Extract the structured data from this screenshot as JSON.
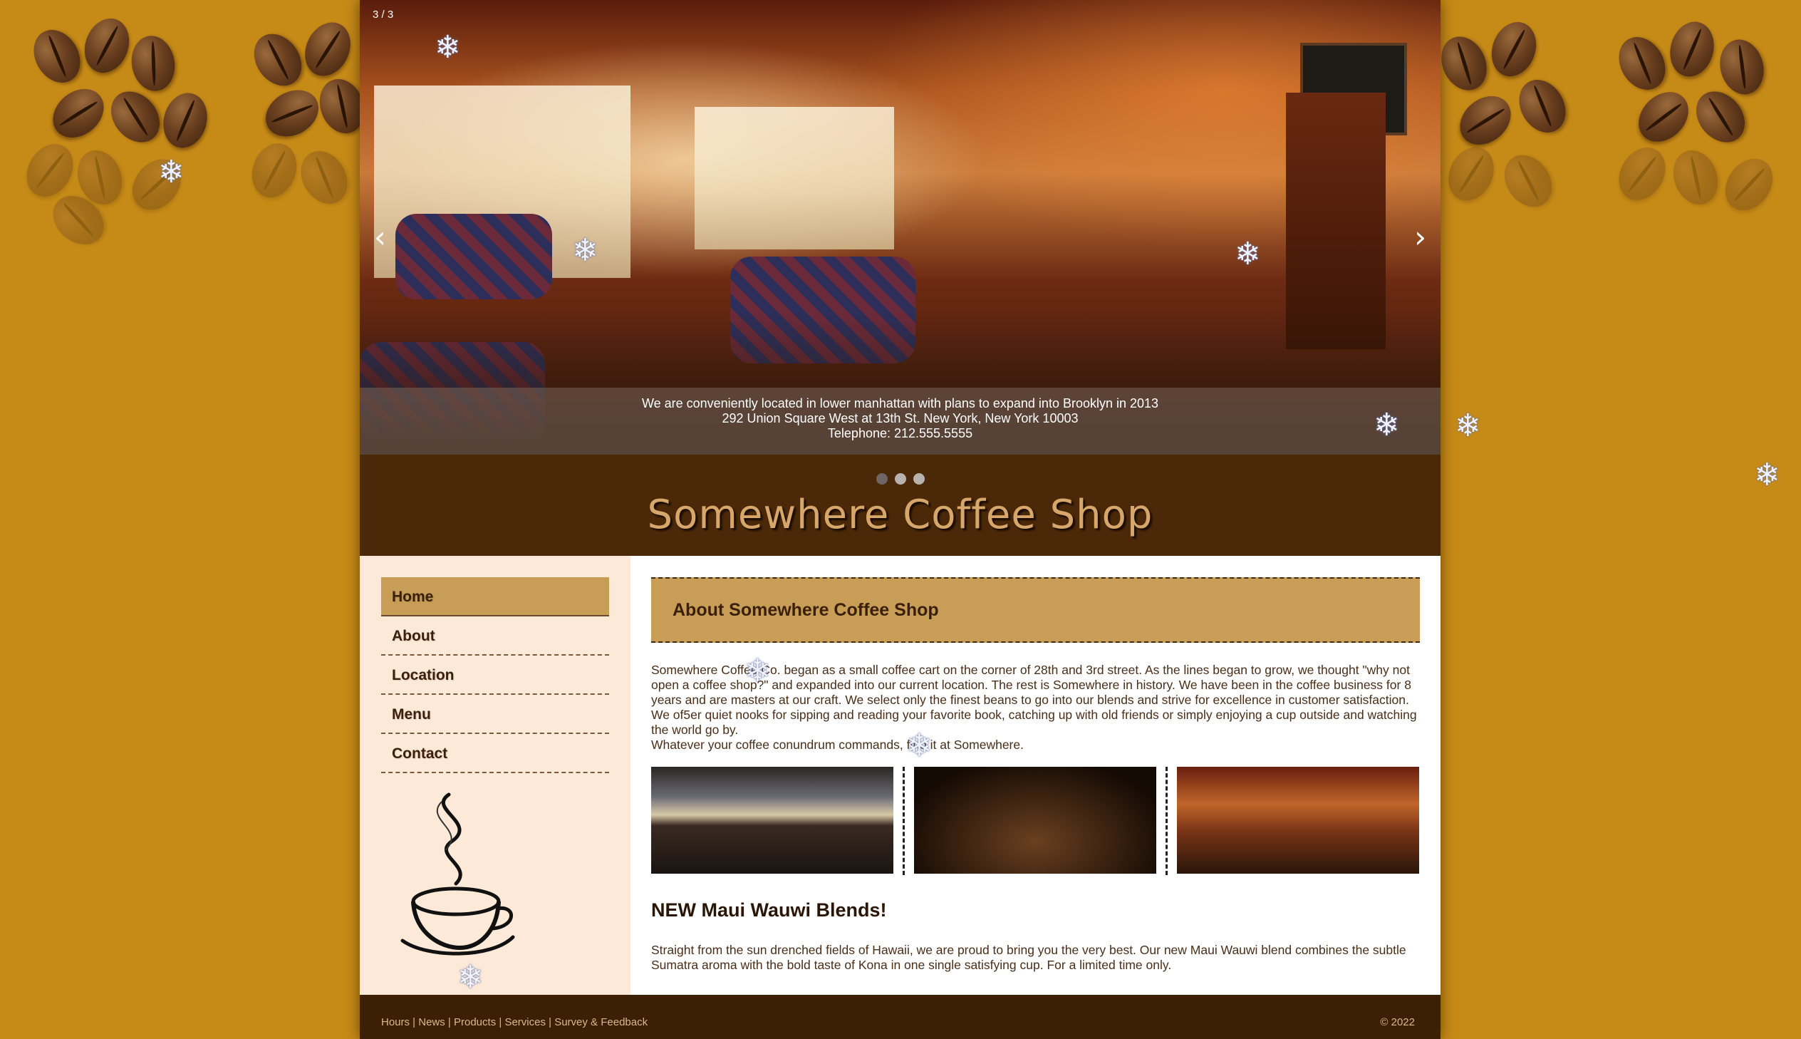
{
  "slider": {
    "counter": "3 / 3",
    "prev": "‹",
    "next": "›",
    "caption": [
      "We are conveniently located in lower manhattan with plans to expand into Brooklyn in 2013",
      "292 Union Square West at 13th St. New York, New York 10003",
      "Telephone: 212.555.5555"
    ]
  },
  "logo": "Somewhere Coffee Shop",
  "nav": [
    "Home",
    "About",
    "Location",
    "Menu",
    "Contact"
  ],
  "about": {
    "heading": "About Somewhere Coffee Shop",
    "paragraph": "Somewhere Coffee Co. began as a small coffee cart on the corner of 28th and 3rd street. As the lines began to grow, we thought \"why not open a coffee shop?\" and expanded into our current location. The rest is Somewhere in history. We have been in the coffee business for 8 years and are masters at our craft. We select only the finest beans to go into our blends and strive for excellence in customer satisfaction. We of5er quiet nooks for sipping and reading your favorite book, catching up with old friends or simply enjoying a cup outside and watching the world go by.",
    "tagline": "Whatever your coffee conundrum commands, find it at Somewhere."
  },
  "news": {
    "heading": "NEW Maui Wauwi Blends!",
    "text": "Straight from the sun drenched fields of Hawaii, we are proud to bring you the very best. Our new Maui Wauwi blend combines the subtle Sumatra aroma with the bold taste of Kona in one single satisfying cup. For a limited time only."
  },
  "footer": {
    "links": [
      "Hours",
      "News",
      "Products",
      "Services",
      "Survey & Feedback"
    ],
    "copyright": "© 2022"
  },
  "colors": {
    "background": "#c68a17",
    "page_brown": "#4a2808",
    "accent_tan": "#c89e57",
    "sidebar_cream": "#fde9d8"
  },
  "icons": [
    "snowflake-icon",
    "chevron-left-icon",
    "chevron-right-icon",
    "coffee-cup-icon"
  ]
}
